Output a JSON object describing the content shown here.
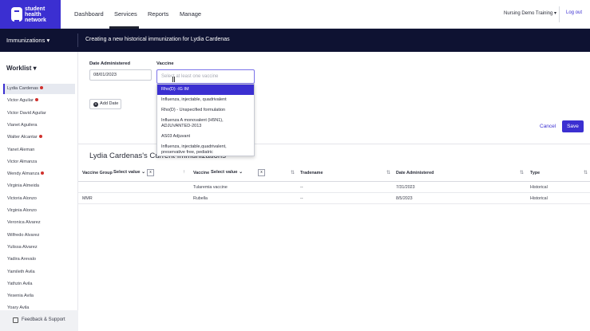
{
  "header": {
    "logo_lines": [
      "student",
      "health",
      "network"
    ],
    "nav": [
      "Dashboard",
      "Services",
      "Reports",
      "Manage"
    ],
    "active_nav": "Services",
    "account": "Nursing Demo Training",
    "logout": "Log out"
  },
  "band": {
    "module": "Immunizations",
    "title": "Creating a new historical immunization for Lydia Cardenas"
  },
  "sidebar": {
    "title": "Worklist",
    "patients": [
      {
        "name": "Lydia Cardenas",
        "alert": true
      },
      {
        "name": "Victor Aguilar",
        "alert": true
      },
      {
        "name": "Victor David Aguilar",
        "alert": false
      },
      {
        "name": "Vianet Aguilera",
        "alert": false
      },
      {
        "name": "Walter Alcantar",
        "alert": true
      },
      {
        "name": "Yanet Aleman",
        "alert": false
      },
      {
        "name": "Victor Almanza",
        "alert": false
      },
      {
        "name": "Wendy Almanza",
        "alert": true
      },
      {
        "name": "Virginia Almeida",
        "alert": false
      },
      {
        "name": "Victoria Alonzo",
        "alert": false
      },
      {
        "name": "Virginia Alonzo",
        "alert": false
      },
      {
        "name": "Veronica Alvarez",
        "alert": false
      },
      {
        "name": "Wilfredo Alvarez",
        "alert": false
      },
      {
        "name": "Yulissa Alvarez",
        "alert": false
      },
      {
        "name": "Yadira Arevalo",
        "alert": false
      },
      {
        "name": "Yamileth Avila",
        "alert": false
      },
      {
        "name": "Yathzin Avila",
        "alert": false
      },
      {
        "name": "Yesenia Avila",
        "alert": false
      },
      {
        "name": "Yoary Avila",
        "alert": false
      }
    ],
    "feedback": "Feedback & Support"
  },
  "form": {
    "date_label": "Date Administered",
    "date_value": "08/01/2023",
    "vaccine_label": "Vaccine",
    "vaccine_placeholder": "Select at least one vaccine",
    "vaccine_options": [
      "Rho(D) -IG IM",
      "Influenza, injectable, quadrivalent",
      "Rho(D) - Unspecified formulation",
      "Influenza A monovalent (H5N1), ADJUVANTED-2013",
      "AS03 Adjuvant",
      "Influenza, injectable,quadrivalent, preservative free, pediatric"
    ],
    "add_date": "Add Date",
    "cancel": "Cancel",
    "save": "Save"
  },
  "current": {
    "title": "Lydia Cardenas's Current Immunizations",
    "columns": {
      "vaccine_group": "Vaccine Group",
      "select_value": "Select value",
      "vaccine": "Vaccine",
      "tradename": "Tradename",
      "date_administered": "Date Administered",
      "type": "Type"
    },
    "clear": "x",
    "rows": [
      {
        "group": "",
        "vaccine": "Tularemia vaccine",
        "tradename": "--",
        "date": "7/31/2023",
        "type": "Historical"
      },
      {
        "group": "MMR",
        "vaccine": "Rubella",
        "tradename": "--",
        "date": "8/5/2023",
        "type": "Historical"
      }
    ]
  },
  "colors": {
    "brand": "#3b2fd1",
    "band": "#0e1232",
    "alert": "#d0312d"
  }
}
